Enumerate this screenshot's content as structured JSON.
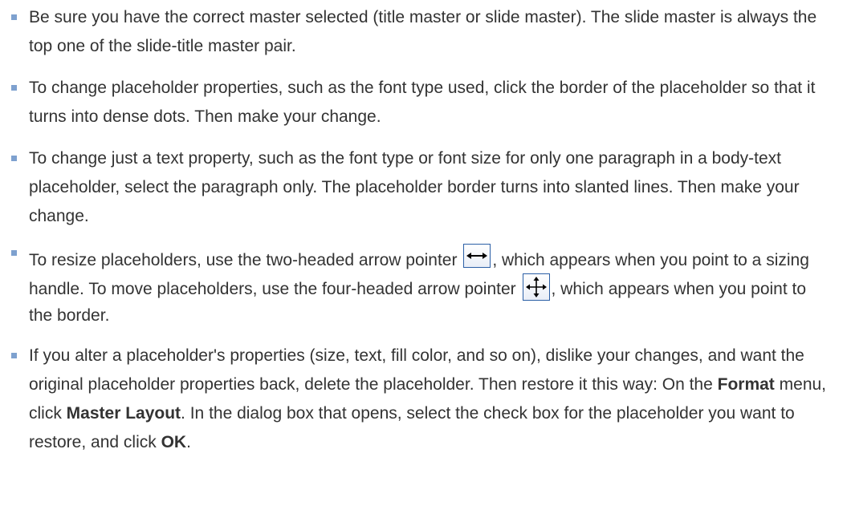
{
  "tips": [
    {
      "text": "Be sure you have the correct master selected (title master or slide master). The slide master is always the top one of the slide-title master pair."
    },
    {
      "text": "To change placeholder properties, such as the font type used, click the border of the placeholder so that it turns into dense dots. Then make your change."
    },
    {
      "text": "To change just a text property, such as the font type or font size for only one paragraph in a body-text placeholder, select the paragraph only. The placeholder border turns into slanted lines. Then make your change."
    },
    {
      "part1": "To resize placeholders, use the two-headed arrow pointer ",
      "part2": ", which appears when you point to a sizing handle. To move placeholders, use the four-headed arrow pointer ",
      "part3": ", which appears when you point to the border.",
      "icon1": "two-headed-arrow-icon",
      "icon2": "four-headed-arrow-icon"
    },
    {
      "part1": "If you alter a placeholder's properties (size, text, fill color, and so on), dislike your changes, and want the original placeholder properties back, delete the placeholder. Then restore it this way: On the ",
      "bold1": "Format",
      "part2": " menu, click ",
      "bold2": "Master Layout",
      "part3": ". In the dialog box that opens, select the check box for the placeholder you want to restore, and click ",
      "bold3": "OK",
      "part4": "."
    }
  ],
  "colors": {
    "text": "#333333",
    "bullet": "#7ea1cf",
    "icon_border": "#2b5fa6"
  }
}
